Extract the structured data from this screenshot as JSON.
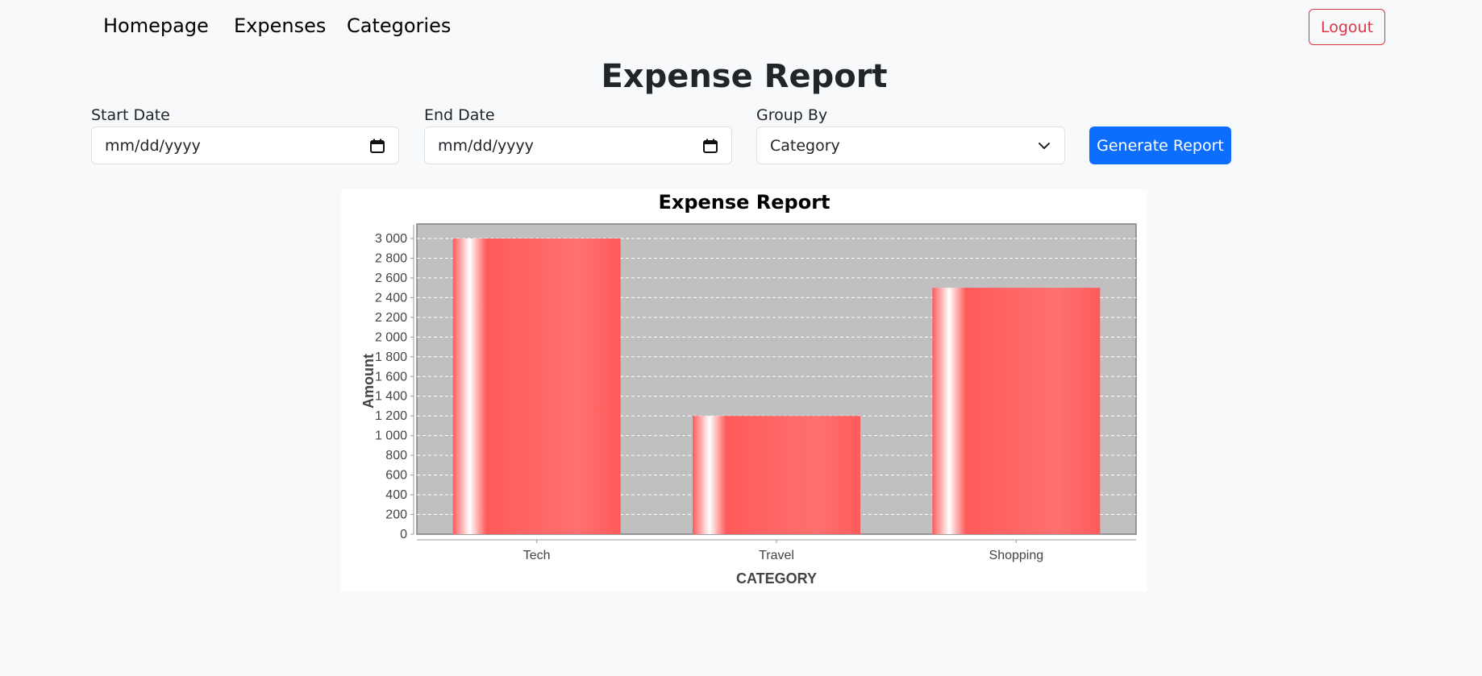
{
  "nav": {
    "links": [
      "Homepage",
      "Expenses",
      "Categories"
    ],
    "logout_label": "Logout"
  },
  "page": {
    "title": "Expense Report"
  },
  "filters": {
    "start_date_label": "Start Date",
    "start_date_value": "mm/dd/yyyy",
    "end_date_label": "End Date",
    "end_date_value": "mm/dd/yyyy",
    "group_by_label": "Group By",
    "group_by_value": "Category",
    "generate_label": "Generate Report"
  },
  "icons": {
    "date_picker": "calendar-icon",
    "dropdown": "chevron-down-icon"
  },
  "colors": {
    "primary": "#0d6efd",
    "danger": "#dc3545",
    "bar": "#ff5a5a",
    "plot_bg": "#c0c0c0"
  },
  "chart_data": {
    "type": "bar",
    "title": "Expense Report",
    "xlabel": "CATEGORY",
    "ylabel": "Amount",
    "categories": [
      "Tech",
      "Travel",
      "Shopping"
    ],
    "values": [
      3000,
      1200,
      2500
    ],
    "ylim": [
      0,
      3100
    ],
    "yticks": [
      0,
      200,
      400,
      600,
      800,
      1000,
      1200,
      1400,
      1600,
      1800,
      2000,
      2200,
      2400,
      2600,
      2800,
      3000
    ],
    "ytick_labels": [
      "0",
      "200",
      "400",
      "600",
      "800",
      "1 000",
      "1 200",
      "1 400",
      "1 600",
      "1 800",
      "2 000",
      "2 200",
      "2 400",
      "2 600",
      "2 800",
      "3 000"
    ],
    "grid": true,
    "legend": false
  }
}
